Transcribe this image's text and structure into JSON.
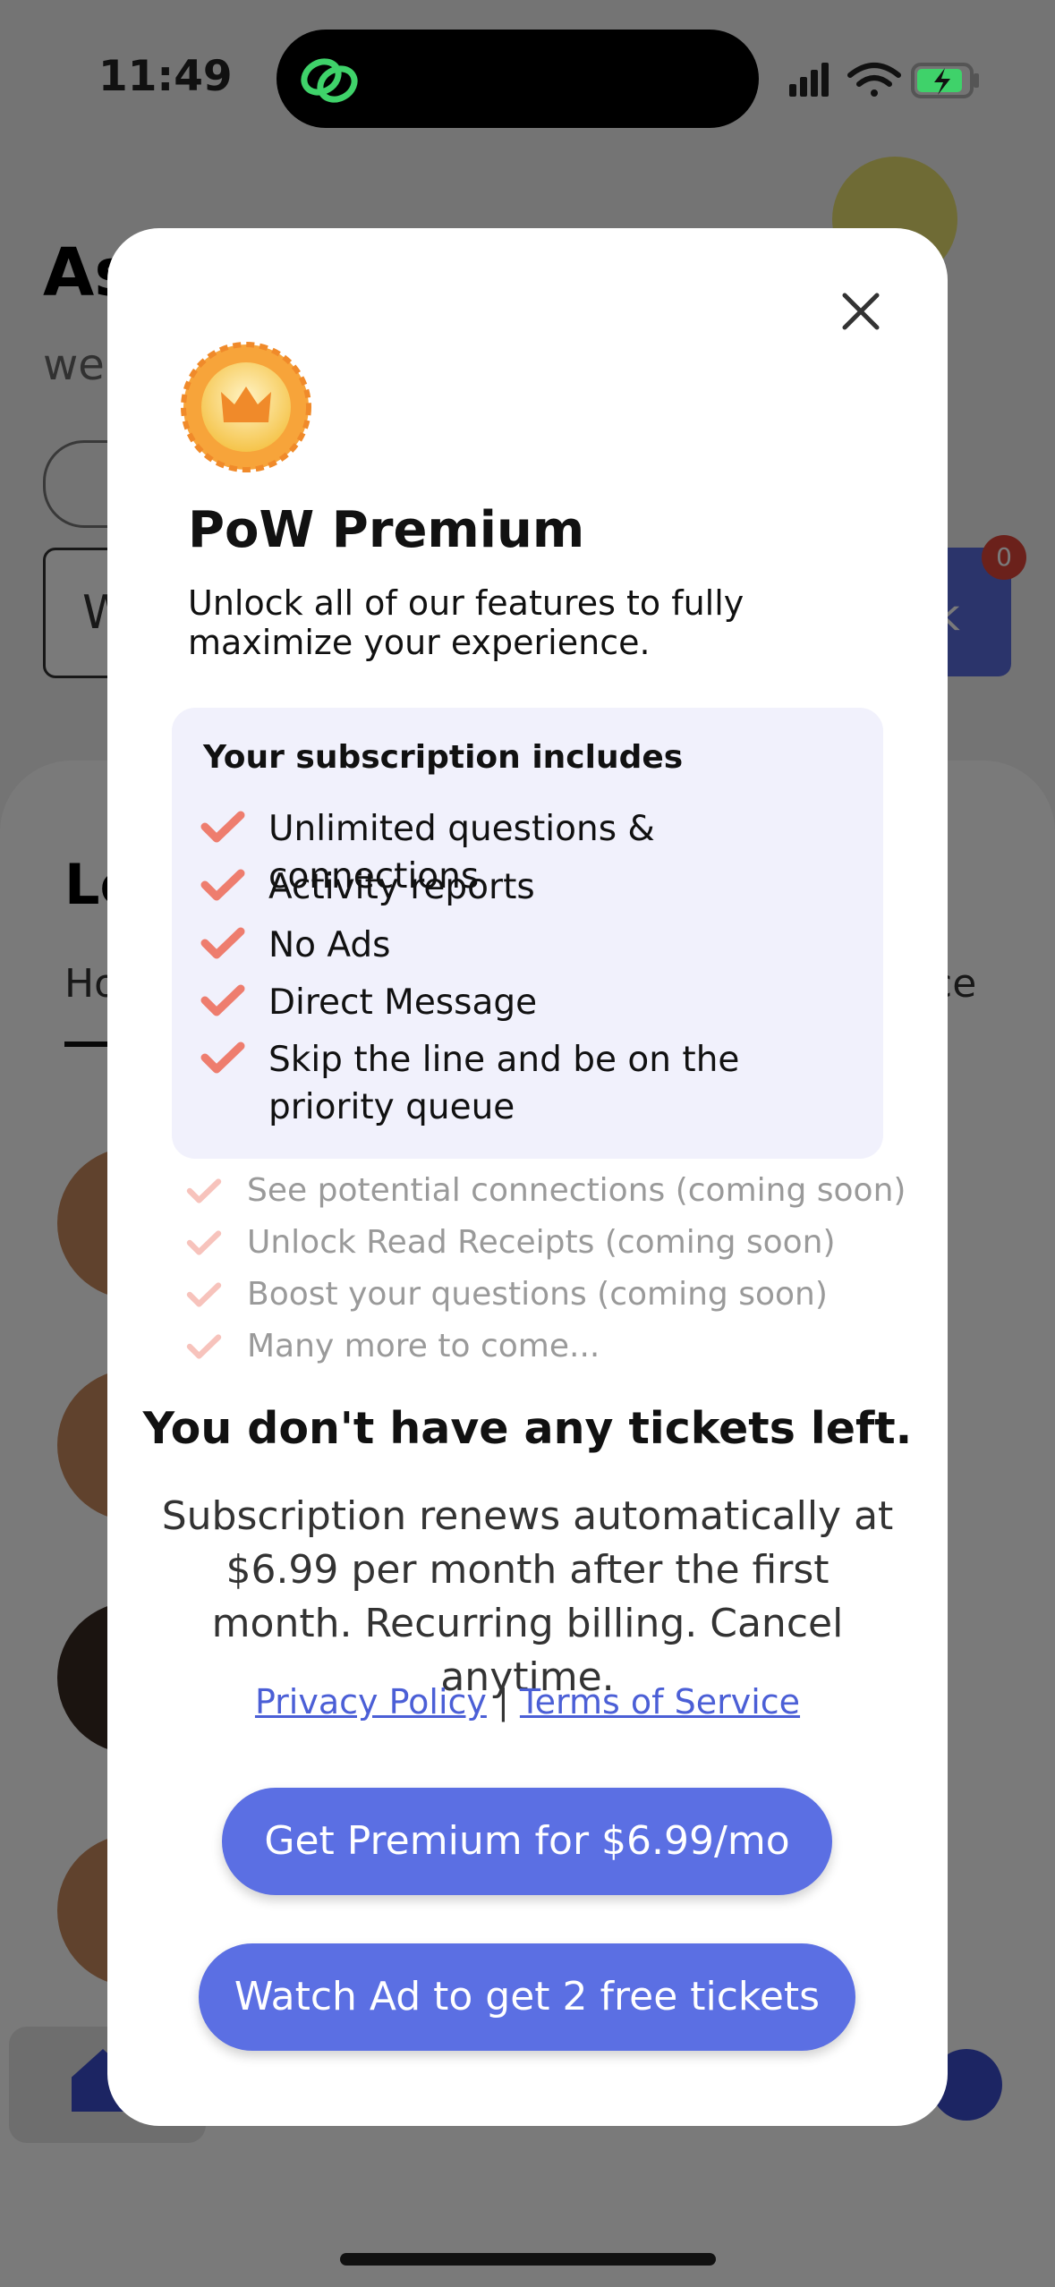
{
  "status_bar": {
    "time": "11:49"
  },
  "background_app": {
    "title_fragment": "As",
    "subtitle_fragment": "we",
    "input_fragment": "W",
    "ask_button_fragment": "sk",
    "notification_count": "0",
    "section_fragment": "Le",
    "tab_left_fragment": "Ho",
    "tab_right_fragment": "ce"
  },
  "modal": {
    "title": "PoW Premium",
    "description": "Unlock all of our features to fully maximize your experience.",
    "includes_heading": "Your subscription includes",
    "features": [
      "Unlimited questions & connections",
      "Activity reports",
      "No Ads",
      "Direct Message",
      "Skip the line and be on the priority queue"
    ],
    "coming_soon": [
      "See potential connections (coming soon)",
      "Unlock Read Receipts (coming soon)",
      "Boost your questions (coming soon)",
      "Many more to come..."
    ],
    "tickets_message": "You don't have any tickets left.",
    "renewal_text": "Subscription renews automatically at $6.99 per month after the first month. Recurring billing. Cancel anytime.",
    "privacy_link": "Privacy Policy",
    "link_separator": "|",
    "terms_link": "Terms of Service",
    "premium_button": "Get Premium for $6.99/mo",
    "ad_button": "Watch Ad to get 2 free tickets"
  },
  "colors": {
    "accent": "#5b6fe3",
    "check": "#ee7d6e",
    "check_faded": "#f7c3bc",
    "medal": "#f7a43a",
    "panel_bg": "#f1f1fc"
  }
}
